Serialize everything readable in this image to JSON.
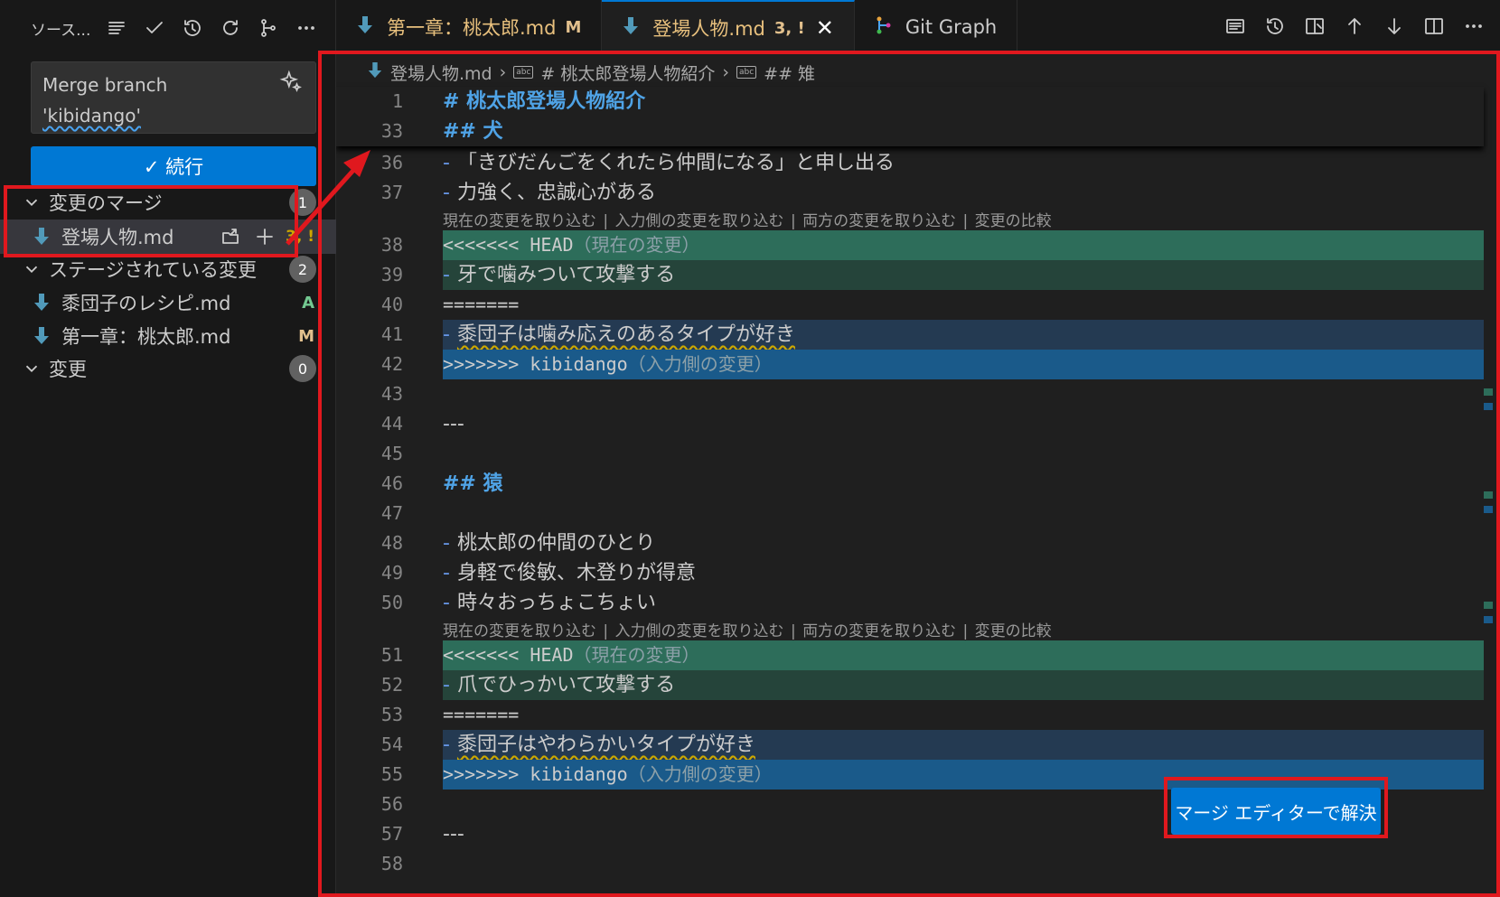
{
  "sidebar": {
    "title": "ソース...",
    "commit_message_line1": "Merge branch",
    "commit_message_line2": "'kibidango'",
    "continue_label": "✓ 続行",
    "sections": [
      {
        "label": "変更のマージ",
        "count": "1"
      },
      {
        "label": "ステージされている変更",
        "count": "2"
      },
      {
        "label": "変更",
        "count": "0"
      }
    ],
    "merge_files": [
      {
        "name": "登場人物.md",
        "status": "3, !"
      }
    ],
    "staged_files": [
      {
        "name": "黍団子のレシピ.md",
        "status": "A",
        "status_color": "#73c991"
      },
      {
        "name": "第一章：桃太郎.md",
        "status": "M",
        "status_color": "#e2c08d"
      }
    ]
  },
  "tabs": [
    {
      "label": "第一章：桃太郎.md",
      "mark": "M"
    },
    {
      "label": "登場人物.md",
      "mark": "3, !",
      "close": "✕"
    },
    {
      "label": "Git Graph"
    }
  ],
  "breadcrumb": {
    "file": "登場人物.md",
    "crumb1": "# 桃太郎登場人物紹介",
    "crumb2": "## 雉"
  },
  "sticky": [
    {
      "n": "1",
      "text": "# 桃太郎登場人物紹介"
    },
    {
      "n": "33",
      "text": "## 犬"
    }
  ],
  "codelens": {
    "accept_current": "現在の変更を取り込む",
    "accept_incoming": "入力側の変更を取り込む",
    "accept_both": "両方の変更を取り込む",
    "compare": "変更の比較",
    "sep": "|"
  },
  "lines": {
    "l36": {
      "n": "36",
      "text": "「きびだんごをくれたら仲間になる」と申し出る"
    },
    "l37": {
      "n": "37",
      "text": "力強く、忠誠心がある"
    },
    "l38": {
      "n": "38",
      "marker": "<<<<<<< HEAD",
      "label": "（現在の変更）"
    },
    "l39": {
      "n": "39",
      "text": "牙で噛みついて攻撃する"
    },
    "l40": {
      "n": "40",
      "text": "======="
    },
    "l41": {
      "n": "41",
      "text": "黍団子は噛み応えのあるタイプが好き"
    },
    "l42": {
      "n": "42",
      "marker": ">>>>>>> kibidango",
      "label": "（入力側の変更）"
    },
    "l43": {
      "n": "43",
      "text": ""
    },
    "l44": {
      "n": "44",
      "text": "---"
    },
    "l45": {
      "n": "45",
      "text": ""
    },
    "l46": {
      "n": "46",
      "text": "## 猿"
    },
    "l47": {
      "n": "47",
      "text": ""
    },
    "l48": {
      "n": "48",
      "text": "桃太郎の仲間のひとり"
    },
    "l49": {
      "n": "49",
      "text": "身軽で俊敏、木登りが得意"
    },
    "l50": {
      "n": "50",
      "text": "時々おっちょこちょい"
    },
    "l51": {
      "n": "51",
      "marker": "<<<<<<< HEAD",
      "label": "（現在の変更）"
    },
    "l52": {
      "n": "52",
      "text": "爪でひっかいて攻撃する"
    },
    "l53": {
      "n": "53",
      "text": "======="
    },
    "l54": {
      "n": "54",
      "text": "黍団子はやわらかいタイプが好き"
    },
    "l55": {
      "n": "55",
      "marker": ">>>>>>> kibidango",
      "label": "（入力側の変更）"
    },
    "l56": {
      "n": "56",
      "text": ""
    },
    "l57": {
      "n": "57",
      "text": "---"
    },
    "l58": {
      "n": "58",
      "text": ""
    }
  },
  "list_dash": "-",
  "resolve_button": "マージ エディターで解決",
  "colors": {
    "accent": "#0078d4",
    "annotation": "#e0181e",
    "current_change": "#2d6d5a",
    "incoming_change": "#1a5a8a"
  }
}
